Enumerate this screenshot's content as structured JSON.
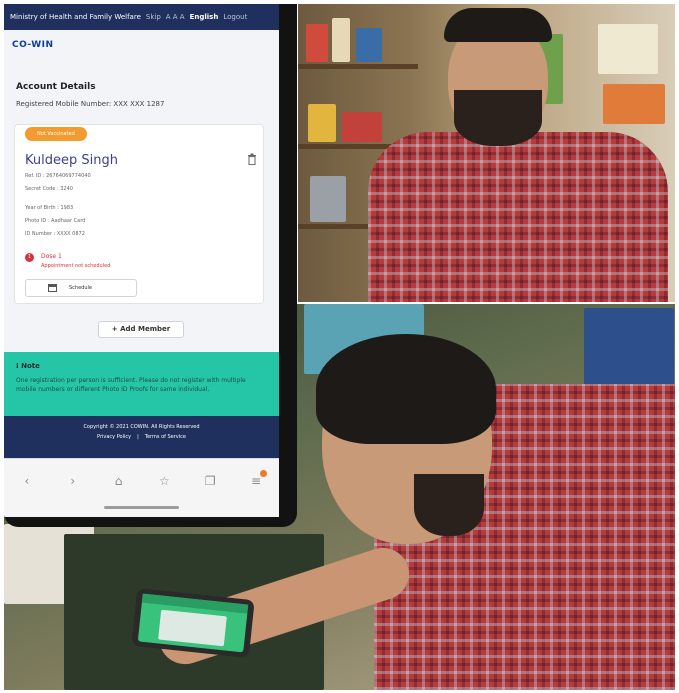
{
  "status_bar": {
    "ministry": "Ministry of Health and Family Welfare",
    "skip": "Skip",
    "font_size": "A A A",
    "language": "English",
    "logout": "Logout"
  },
  "app": {
    "logo": "CO-WIN",
    "account_title": "Account Details",
    "registered_mobile": "Registered Mobile Number: XXX XXX 1287",
    "badge": "Not Vaccinated",
    "member_name": "Kuldeep Singh",
    "details": [
      "Ref. ID : 26764069774040",
      "Secret Code : 3240",
      "Year of Birth : 1983",
      "Photo ID : Aadhaar Card",
      "ID Number : XXXX 0872"
    ],
    "dose_number": "1",
    "dose_label": "Dose 1",
    "dose_status": "Appointment not scheduled",
    "schedule_label": "Schedule",
    "add_member": "+ Add Member",
    "note_title": "Note",
    "note_text": "One registration per person is sufficient. Please do not register with multiple mobile numbers or different Photo ID Proofs for same individual.",
    "footer_copyright": "Copyright © 2021 COWIN. All Rights Reserved",
    "footer_privacy": "Privacy Policy",
    "footer_terms": "Terms of Service",
    "footer_separator": "|"
  },
  "browser_nav": {
    "icons": [
      "back-icon",
      "forward-icon",
      "home-icon",
      "bookmark-star-icon",
      "tabs-icon",
      "menu-icon"
    ],
    "glyphs": [
      "‹",
      "›",
      "⌂",
      "☆",
      "❐",
      "≡"
    ]
  },
  "colors": {
    "header_navy": "#1f2f5e",
    "badge_orange": "#f39b2e",
    "note_teal": "#25c6a7",
    "name_blue": "#3b3f8c",
    "alert_red": "#d8323a"
  }
}
